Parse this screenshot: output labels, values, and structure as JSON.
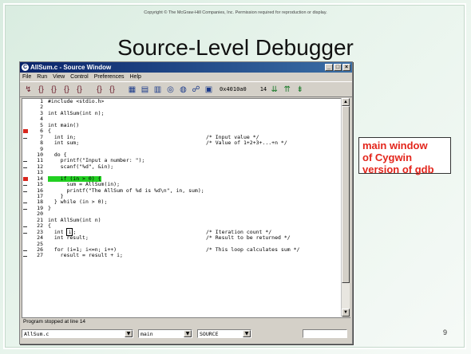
{
  "copyright": "Copyright © The McGraw-Hill Companies, Inc. Permission required for reproduction or display.",
  "slide_title": "Source-Level Debugger",
  "page_number": "9",
  "annotation": [
    "main window",
    "of Cygwin",
    "version of gdb"
  ],
  "window": {
    "title": "AllSum.c - Source Window",
    "menu": [
      "File",
      "Run",
      "View",
      "Control",
      "Preferences",
      "Help"
    ],
    "address": "0x4010a0",
    "line_field": "14",
    "status": "Program stopped at line 14",
    "file_combo": "AllSum.c",
    "func_combo": "main",
    "mode_combo": "SOURCE"
  },
  "code": [
    {
      "n": "1",
      "m": "",
      "src": "#include <stdio.h>",
      "cmt": ""
    },
    {
      "n": "2",
      "m": "",
      "src": "",
      "cmt": ""
    },
    {
      "n": "3",
      "m": "",
      "src": "int AllSum(int n);",
      "cmt": ""
    },
    {
      "n": "4",
      "m": "",
      "src": "",
      "cmt": ""
    },
    {
      "n": "5",
      "m": "",
      "src": "int main()",
      "cmt": ""
    },
    {
      "n": "6",
      "m": "bp",
      "src": "{",
      "cmt": ""
    },
    {
      "n": "7",
      "m": "dash",
      "src": "  int in;",
      "cmt": "/* Input value */"
    },
    {
      "n": "8",
      "m": "",
      "src": "  int sum;",
      "cmt": "/* Value of 1+2+3+...+n */"
    },
    {
      "n": "9",
      "m": "",
      "src": "",
      "cmt": ""
    },
    {
      "n": "10",
      "m": "",
      "src": "  do {",
      "cmt": ""
    },
    {
      "n": "11",
      "m": "dash",
      "src": "    printf(\"Input a number: \");",
      "cmt": ""
    },
    {
      "n": "12",
      "m": "dash",
      "src": "    scanf(\"%d\", &in);",
      "cmt": ""
    },
    {
      "n": "13",
      "m": "",
      "src": "",
      "cmt": ""
    },
    {
      "n": "14",
      "m": "bp",
      "src": "    if (in > 0) {",
      "cmt": "",
      "hl": true
    },
    {
      "n": "15",
      "m": "dash",
      "src": "      sum = AllSum(in);",
      "cmt": ""
    },
    {
      "n": "16",
      "m": "dash",
      "src": "      printf(\"The AllSum of %d is %d\\n\", in, sum);",
      "cmt": ""
    },
    {
      "n": "17",
      "m": "",
      "src": "    }",
      "cmt": ""
    },
    {
      "n": "18",
      "m": "dash",
      "src": "  } while (in > 0);",
      "cmt": ""
    },
    {
      "n": "19",
      "m": "dash",
      "src": "}",
      "cmt": ""
    },
    {
      "n": "20",
      "m": "",
      "src": "",
      "cmt": ""
    },
    {
      "n": "21",
      "m": "",
      "src": "int AllSum(int n)",
      "cmt": ""
    },
    {
      "n": "22",
      "m": "dash",
      "src": "{",
      "cmt": ""
    },
    {
      "n": "23",
      "m": "dash",
      "src": "  int i;",
      "cmt": "/* Iteration count */",
      "cursor": true
    },
    {
      "n": "24",
      "m": "",
      "src": "  int result;",
      "cmt": "/* Result to be returned */"
    },
    {
      "n": "25",
      "m": "",
      "src": "",
      "cmt": ""
    },
    {
      "n": "26",
      "m": "dash",
      "src": "  for (i=1; i<=n; i++)",
      "cmt": "/* This loop calculates sum */"
    },
    {
      "n": "27",
      "m": "dash",
      "src": "    result = result + i;",
      "cmt": ""
    }
  ]
}
